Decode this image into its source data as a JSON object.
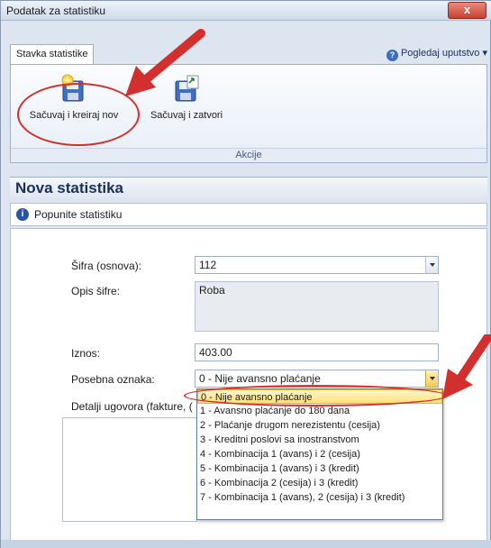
{
  "window": {
    "title": "Podatak za statistiku",
    "close_label": "x"
  },
  "ribbon": {
    "tab_label": "Stavka statistike",
    "help_label": "Pogledaj uputstvo",
    "help_chevron": "▾",
    "buttons": [
      {
        "label": "Sačuvaj i kreiraj nov",
        "icon": "save-new-icon"
      },
      {
        "label": "Sačuvaj i zatvori",
        "icon": "save-close-icon"
      }
    ],
    "group_label": "Akcije"
  },
  "section": {
    "title": "Nova statistika",
    "info_text": "Popunite statistiku",
    "info_icon": "i"
  },
  "form": {
    "sifra_label": "Šifra (osnova):",
    "sifra_value": "112",
    "opis_label": "Opis šifre:",
    "opis_value": "Roba",
    "iznos_label": "Iznos:",
    "iznos_value": "403.00",
    "oznaka_label": "Posebna oznaka:",
    "oznaka_value": "0 - Nije avansno plaćanje",
    "detalji_label": "Detalji ugovora (fakture, ("
  },
  "dropdown_options": [
    "0 - Nije avansno plaćanje",
    "1 - Avansno plaćanje do 180 dana",
    "2 - Plaćanje drugom nerezistentu (cesija)",
    "3 - Kreditni poslovi sa inostranstvom",
    "4 - Kombinacija 1 (avans) i 2 (cesija)",
    "5 - Kombinacija 1 (avans) i 3 (kredit)",
    "6 - Kombinacija 2 (cesija) i 3 (kredit)",
    "7 - Kombinacija 1 (avans), 2 (cesija) i 3 (kredit)"
  ],
  "colors": {
    "annotation_red": "#d32f2f",
    "selected_highlight": "#ffe17a",
    "title_blue": "#1b2f5b"
  }
}
